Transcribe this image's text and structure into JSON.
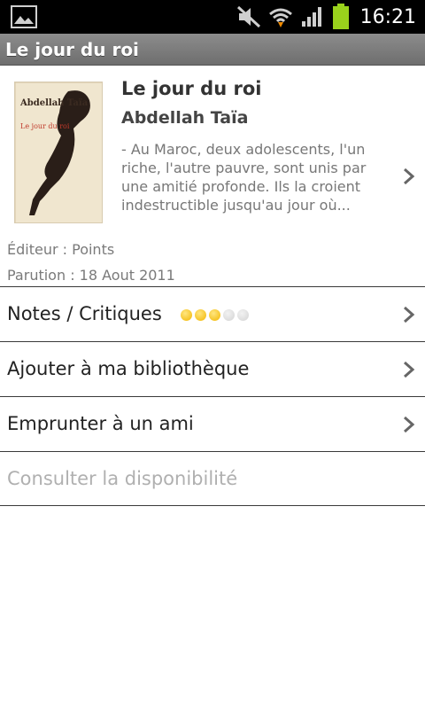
{
  "statusbar": {
    "time": "16:21",
    "icons": [
      "gallery-icon",
      "mute-icon",
      "wifi-icon",
      "signal-icon",
      "battery-icon"
    ],
    "battery_color": "#9ad21c"
  },
  "app": {
    "title": "Le jour du roi"
  },
  "book": {
    "title": "Le jour du roi",
    "author": "Abdellah Taïa",
    "summary": "- Au Maroc, deux adolescents, l'un riche, l'autre pauvre, sont unis par une amitié profonde. Ils  la croient indestructible jusqu'au jour où...",
    "editor": "Éditeur : Points",
    "release": "Parution : 18 Aout 2011",
    "cover": {
      "author_text": "Abdellah Taïa",
      "title_text": "Le jour du roi"
    }
  },
  "rows": [
    {
      "label": "Notes / Critiques",
      "rating": 3,
      "rating_max": 5,
      "enabled": true
    },
    {
      "label": "Ajouter à ma bibliothèque",
      "enabled": true
    },
    {
      "label": "Emprunter à un ami",
      "enabled": true
    },
    {
      "label": "Consulter la disponibilité",
      "enabled": false
    }
  ],
  "colors": {
    "rating_on": "#f2b600",
    "rating_off": "#d3d3d3",
    "title_bar": "#7d7d7d"
  }
}
